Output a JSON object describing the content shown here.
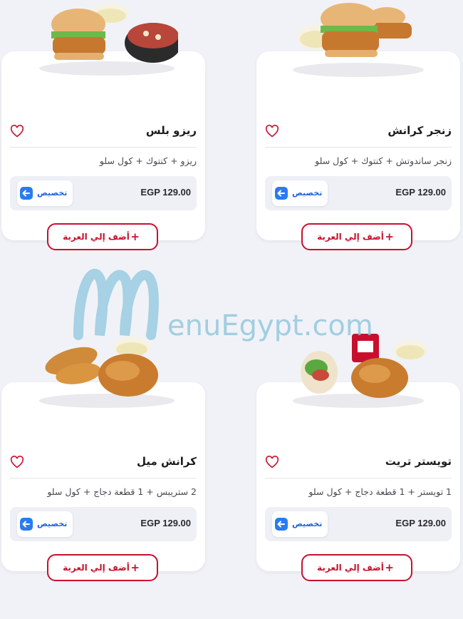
{
  "customize_label": "تخصيص",
  "add_to_cart_label": "أضف إلي العربة",
  "add_icon": "+",
  "watermark": "MenuEgypt.com",
  "items": [
    {
      "name": "ريزو بلس",
      "description": "ريزو + كنتوك + كول سلو",
      "price": "EGP 129.00"
    },
    {
      "name": "زنجر كرانش",
      "description": "زنجر ساندوتش + كنتوك + كول سلو",
      "price": "EGP 129.00"
    },
    {
      "name": "كرانش ميل",
      "description": "2 ستريبس + 1 قطعة دجاج + كول سلو",
      "price": "EGP 129.00"
    },
    {
      "name": "تويستر تريت",
      "description": "1 تويستر + 1 قطعة دجاج + كول سلو",
      "price": "EGP 129.00"
    }
  ],
  "colors": {
    "brand_red": "#c8102e",
    "accent_blue": "#2a7bf0",
    "background": "#f1f2f7"
  }
}
